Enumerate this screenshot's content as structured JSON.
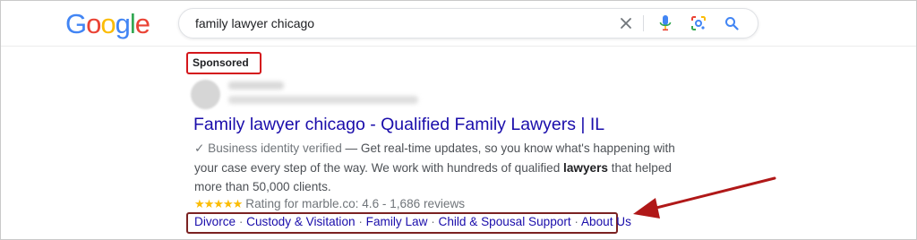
{
  "header": {
    "logo_letters": [
      {
        "char": "G",
        "color": "#4285f4"
      },
      {
        "char": "o",
        "color": "#ea4335"
      },
      {
        "char": "o",
        "color": "#fbbc05"
      },
      {
        "char": "g",
        "color": "#4285f4"
      },
      {
        "char": "l",
        "color": "#34a853"
      },
      {
        "char": "e",
        "color": "#ea4335"
      }
    ],
    "search": {
      "value": "family lawyer chicago",
      "icons": [
        "clear-icon",
        "microphone-icon",
        "lens-icon",
        "search-icon"
      ]
    }
  },
  "ad": {
    "sponsored_label": "Sponsored",
    "title": "Family lawyer chicago - Qualified Family Lawyers | IL",
    "verified_check": "✓",
    "verified_label": "Business identity verified",
    "desc_part1": " — Get real-time updates, so you know what's happening with your case every step of the way. We work with hundreds of qualified ",
    "desc_bold": "lawyers",
    "desc_part2": " that helped more than 50,000 clients.",
    "stars": "★★★★★",
    "rating_text": "Rating for marble.co: 4.6 - 1,686 reviews",
    "rating_value": 4.6,
    "sitelinks": [
      "Divorce",
      "Custody & Visitation",
      "Family Law",
      "Child & Spousal Support",
      "About Us"
    ],
    "sitelink_separator": " · "
  },
  "annotations": {
    "highlight_color": "#d4161b",
    "sitelink_box_color": "#7b2222",
    "arrow_color": "#b01818"
  },
  "colors": {
    "link": "#1a0dab",
    "text": "#4d5156"
  }
}
